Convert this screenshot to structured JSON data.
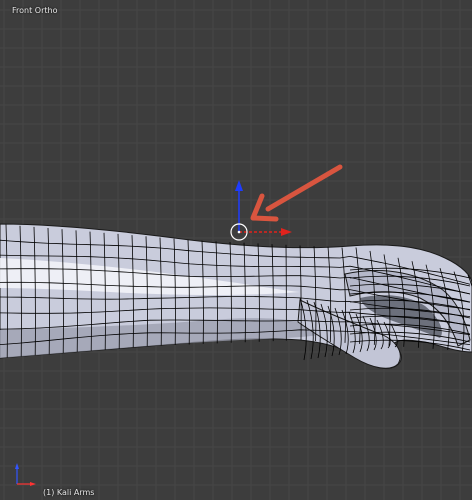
{
  "viewport": {
    "view_label": "Front Ortho",
    "object_label": "(1) Kali Arms",
    "background_color": "#3d3d3d",
    "grid_color": "#474747"
  },
  "gizmo": {
    "z_axis_color": "#1e3cff",
    "x_axis_color": "#e0231d",
    "pivot_icon": "3d-cursor-icon"
  },
  "annotation": {
    "arrow_color": "#d9553f",
    "arrow_icon": "pointer-arrow-icon"
  },
  "mesh": {
    "fill_color": "#c9ccdc",
    "wire_color": "#000000"
  },
  "mini_axis": {
    "z_color": "#3355ff",
    "x_color": "#ff3333"
  }
}
